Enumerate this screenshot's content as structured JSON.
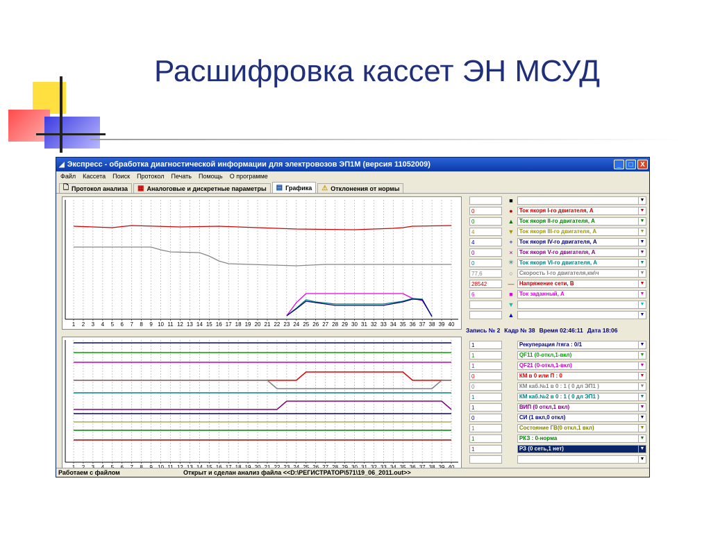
{
  "slide": {
    "title": "Расшифровка кассет ЭН МСУД"
  },
  "window": {
    "title": "Экспресс - обработка диагностической информации для электровозов ЭП1М (версия 11052009)",
    "controls": [
      "_",
      "□",
      "X"
    ]
  },
  "menu": [
    "Файл",
    "Кассета",
    "Поиск",
    "Протокол",
    "Печать",
    "Помощь",
    "О программе"
  ],
  "tabs": [
    {
      "label": "Протокол анализа",
      "icon": "document-icon",
      "active": false
    },
    {
      "label": "Аналоговые и дискретные параметры",
      "icon": "grid-icon",
      "active": false
    },
    {
      "label": "Графика",
      "icon": "chart-icon",
      "active": true
    },
    {
      "label": "Отклонения от нормы",
      "icon": "warning-icon",
      "active": false
    }
  ],
  "axis_ticks": [
    "1",
    "2",
    "3",
    "4",
    "5",
    "6",
    "7",
    "8",
    "9",
    "10",
    "11",
    "12",
    "13",
    "14",
    "15",
    "16",
    "17",
    "18",
    "19",
    "20",
    "21",
    "22",
    "23",
    "24",
    "25",
    "26",
    "27",
    "28",
    "29",
    "30",
    "31",
    "32",
    "33",
    "34",
    "35",
    "36",
    "37",
    "38",
    "39",
    "40"
  ],
  "analog_params": [
    {
      "value": "",
      "marker": "■",
      "label": "",
      "color": "#000000"
    },
    {
      "value": "0",
      "marker": "●",
      "label": "Ток якоря I-го двигателя, А",
      "color": "#c00000"
    },
    {
      "value": "0",
      "marker": "▲",
      "label": "Ток якоря  II-го двигателя, А",
      "color": "#008000"
    },
    {
      "value": "4",
      "marker": "▼",
      "label": "Ток якоря  III-го двигателя, А",
      "color": "#999900"
    },
    {
      "value": "4",
      "marker": "+",
      "label": "Ток якоря IV-го двигателя, А",
      "color": "#000080"
    },
    {
      "value": "0",
      "marker": "×",
      "label": "Ток якоря V-го двигателя, А",
      "color": "#800080"
    },
    {
      "value": "0",
      "marker": "✳",
      "label": "Ток якоря VI-го двигателя, А",
      "color": "#008080"
    },
    {
      "value": "77,6",
      "marker": "○",
      "label": "Скорость I-го  двигателя,км\\ч",
      "color": "#808080"
    },
    {
      "value": "28542",
      "marker": "—",
      "label": "Напряжение сети, В",
      "color": "#c00000"
    },
    {
      "value": "6",
      "marker": "■",
      "label": "Ток заданный, А",
      "color": "#e000e0"
    },
    {
      "value": "",
      "marker": "▼",
      "label": "",
      "color": "#00c0c0"
    },
    {
      "value": "",
      "marker": "▲",
      "label": "",
      "color": "#0000c0"
    }
  ],
  "record_info": {
    "record": "Запись № 2",
    "frame": "Кадр № 38",
    "time": "Время 02:46:11",
    "date": "Дата 18:06"
  },
  "discrete_params": [
    {
      "value": "1",
      "label": "Рекуперация /тяга  : 0/1",
      "color": "#000080",
      "selected": false
    },
    {
      "value": "1",
      "label": "QF11 (0-откл,1-вкл)",
      "color": "#00a000",
      "selected": false
    },
    {
      "value": "1",
      "label": "QF21 (0-откл,1-вкл)",
      "color": "#c000c0",
      "selected": false
    },
    {
      "value": "0",
      "label": "КМ в 0 или П : 0",
      "color": "#e00000",
      "selected": false
    },
    {
      "value": "0",
      "label": "КМ каб.№1 в 0 : 1  ( 0 дл ЭП1 )",
      "color": "#808080",
      "selected": false
    },
    {
      "value": "1",
      "label": "КМ каб.№2 в 0 : 1  ( 0 дл ЭП1 )",
      "color": "#008080",
      "selected": false
    },
    {
      "value": "1",
      "label": "ВИП (0 откл,1 вкл)",
      "color": "#800080",
      "selected": false
    },
    {
      "value": "0",
      "label": "СИ (1 вкл,0 откл)",
      "color": "#000080",
      "selected": false
    },
    {
      "value": "1",
      "label": "Состояние ГВ(0 откл,1 вкл)",
      "color": "#808000",
      "selected": false
    },
    {
      "value": "1",
      "label": "РКЗ : 0-норма",
      "color": "#008000",
      "selected": false
    },
    {
      "value": "1",
      "label": "РЗ (0 сеть,1 нет)",
      "color": "#ffffff",
      "selected": true
    },
    {
      "value": "",
      "label": "",
      "color": "#000000",
      "selected": false
    }
  ],
  "status": {
    "left": "Работаем с файлом",
    "right": "Открыт и сделан анализ файла  <<D:\\РЕГИСТРАТОР\\571\\19_06_2011.out>>"
  }
}
